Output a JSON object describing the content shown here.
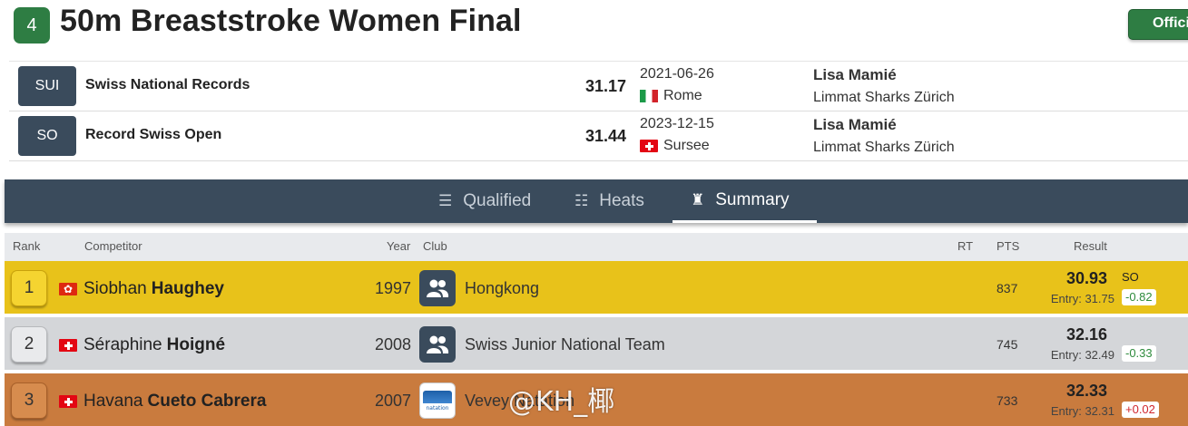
{
  "event": {
    "number": "4",
    "title": "50m Breaststroke Women Final",
    "status_button": "Official"
  },
  "records": [
    {
      "code": "SUI",
      "name": "Swiss National Records",
      "time": "31.17",
      "date": "2021-06-26",
      "flag": "italy-flag",
      "place": "Rome",
      "holder": "Lisa Mamié",
      "club": "Limmat Sharks Zürich"
    },
    {
      "code": "SO",
      "name": "Record Swiss Open",
      "time": "31.44",
      "date": "2023-12-15",
      "flag": "switzerland-flag",
      "place": "Sursee",
      "holder": "Lisa Mamié",
      "club": "Limmat Sharks Zürich"
    }
  ],
  "tabs": [
    {
      "label": "Qualified",
      "icon": "ordered-list-icon",
      "active": false
    },
    {
      "label": "Heats",
      "icon": "numbered-list-icon",
      "active": false
    },
    {
      "label": "Summary",
      "icon": "podium-icon",
      "active": true
    }
  ],
  "table": {
    "headers": {
      "rank": "Rank",
      "competitor": "Competitor",
      "year": "Year",
      "club": "Club",
      "rt": "RT",
      "pts": "PTS",
      "result": "Result"
    },
    "rows": [
      {
        "rank": "1",
        "flag": "hong-kong-flag",
        "first": "Siobhan",
        "last": "Haughey",
        "year": "1997",
        "club": "Hongkong",
        "club_icon": "group-icon",
        "rt": "",
        "pts": "837",
        "time": "30.93",
        "entry": "Entry: 31.75",
        "record": "SO",
        "diff": "-0.82"
      },
      {
        "rank": "2",
        "flag": "switzerland-flag",
        "first": "Séraphine",
        "last": "Hoigné",
        "year": "2008",
        "club": "Swiss Junior National Team",
        "club_icon": "group-icon",
        "rt": "",
        "pts": "745",
        "time": "32.16",
        "entry": "Entry: 32.49",
        "record": "",
        "diff": "-0.33"
      },
      {
        "rank": "3",
        "flag": "switzerland-flag",
        "first": "Havana",
        "last": "Cueto Cabrera",
        "year": "2007",
        "club": "Vevey Natation",
        "club_icon": "club-logo",
        "rt": "",
        "pts": "733",
        "time": "32.33",
        "entry": "Entry: 32.31",
        "record": "",
        "diff": "+0.02"
      }
    ]
  },
  "watermark": "@KH_椰",
  "colors": {
    "accent_green": "#2e7d43",
    "navy": "#3a4b5c",
    "gold": "#e8c21a",
    "silver": "#d4d6d9",
    "bronze": "#c97b3e"
  }
}
